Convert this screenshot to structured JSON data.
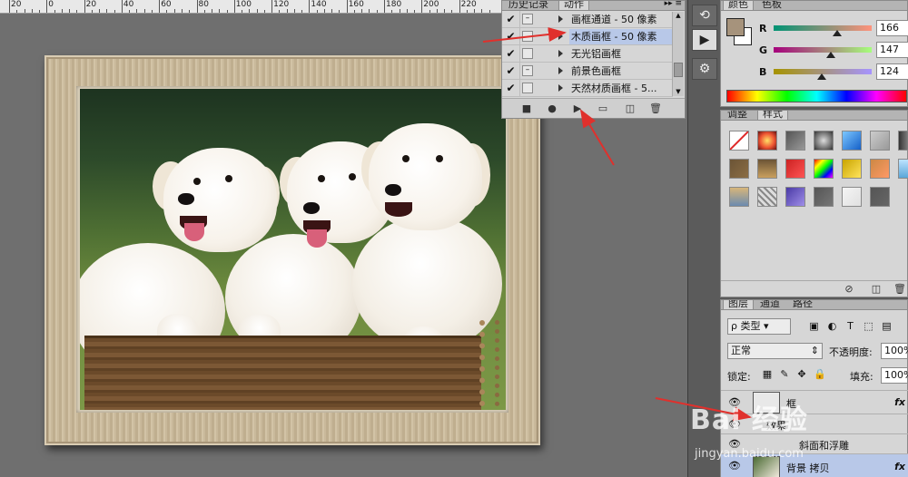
{
  "ruler": {
    "labels": [
      "20",
      "0",
      "20",
      "40",
      "60",
      "80",
      "100",
      "120",
      "140",
      "160",
      "180",
      "200",
      "220"
    ]
  },
  "actions_panel": {
    "tabs": [
      "历史记录",
      "动作"
    ],
    "active_tab": "动作",
    "rows": [
      {
        "checked": true,
        "dialog": true,
        "name": "画框通道 - 50 像素",
        "selected": false
      },
      {
        "checked": true,
        "dialog": false,
        "name": "木质画框 - 50 像素",
        "selected": true
      },
      {
        "checked": true,
        "dialog": false,
        "name": "无光铝画框",
        "selected": false
      },
      {
        "checked": true,
        "dialog": true,
        "name": "前景色画框",
        "selected": false
      },
      {
        "checked": true,
        "dialog": false,
        "name": "天然材质画框 - 5...",
        "selected": false
      }
    ],
    "footer_buttons": [
      "stop-icon",
      "record-icon",
      "play-icon",
      "new-set-icon",
      "new-action-icon",
      "trash-icon"
    ]
  },
  "color_panel": {
    "tabs": [
      "颜色",
      "色板"
    ],
    "active_tab": "颜色",
    "foreground": "#a6937c",
    "background": "#ffffff",
    "channels": [
      {
        "label": "R",
        "value": "166",
        "level": 0.65
      },
      {
        "label": "G",
        "value": "147",
        "level": 0.58
      },
      {
        "label": "B",
        "value": "124",
        "level": 0.49
      }
    ]
  },
  "styles_panel": {
    "tabs": [
      "调整",
      "样式"
    ],
    "active_tab": "样式"
  },
  "layers_panel": {
    "tabs": [
      "图层",
      "通道",
      "路径"
    ],
    "active_tab": "图层",
    "kind_label": "ρ 类型",
    "blend_mode": "正常",
    "opacity_label": "不透明度:",
    "opacity_value": "100%",
    "lock_label": "锁定:",
    "fill_label": "填充:",
    "fill_value": "100%",
    "layers": [
      {
        "name": "框",
        "fx": "fx",
        "type": "layer"
      },
      {
        "name": "效果",
        "fx": "",
        "type": "effects"
      },
      {
        "name": "斜面和浮雕",
        "fx": "",
        "type": "effect"
      },
      {
        "name": "背景 拷贝",
        "fx": "fx",
        "type": "layer"
      }
    ]
  },
  "watermark": {
    "main": "Bai 经验",
    "sub": "jingyan.baidu.com"
  }
}
